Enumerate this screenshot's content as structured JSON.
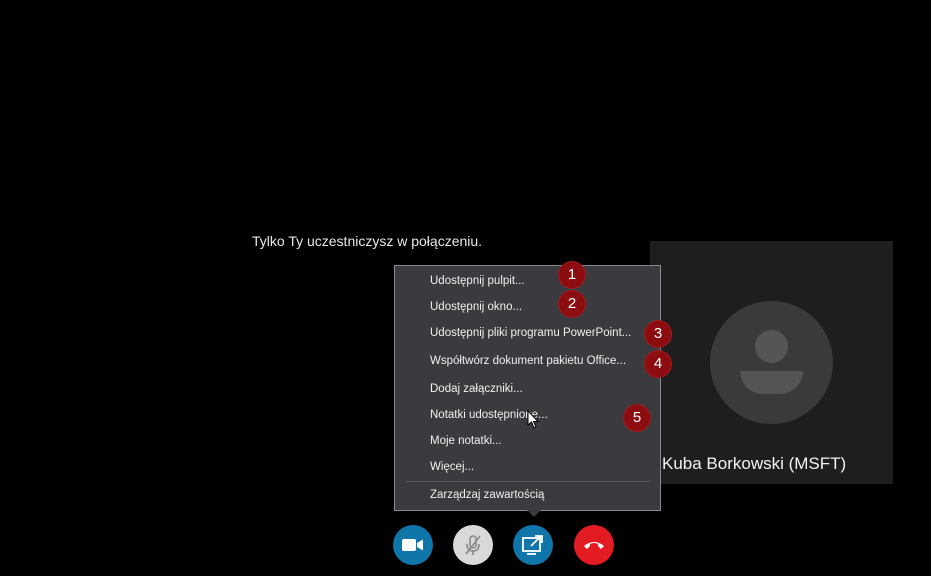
{
  "call": {
    "status_text": "Tylko Ty uczestniczysz w połączeniu.",
    "participant_name": "Kuba Borkowski (MSFT)"
  },
  "share_menu": {
    "items": [
      {
        "label": "Udostępnij pulpit..."
      },
      {
        "label": "Udostępnij okno..."
      },
      {
        "label": "Udostępnij pliki programu PowerPoint..."
      },
      {
        "label": "Współtwórz dokument pakietu Office..."
      },
      {
        "label": "Dodaj załączniki..."
      },
      {
        "label": "Notatki udostępnione..."
      },
      {
        "label": "Moje notatki..."
      },
      {
        "label": "Więcej..."
      },
      {
        "label": "Zarządzaj zawartością"
      }
    ]
  },
  "badges": [
    "1",
    "2",
    "3",
    "4",
    "5"
  ],
  "controls": {
    "video_icon": "video-camera-icon",
    "mic_icon": "microphone-muted-icon",
    "share_icon": "share-screen-icon",
    "hangup_icon": "hang-up-icon"
  },
  "colors": {
    "accent_blue": "#1075a8",
    "hangup_red": "#e31b23",
    "badge_red": "#8b0d10",
    "menu_bg": "#3b3b3f"
  }
}
